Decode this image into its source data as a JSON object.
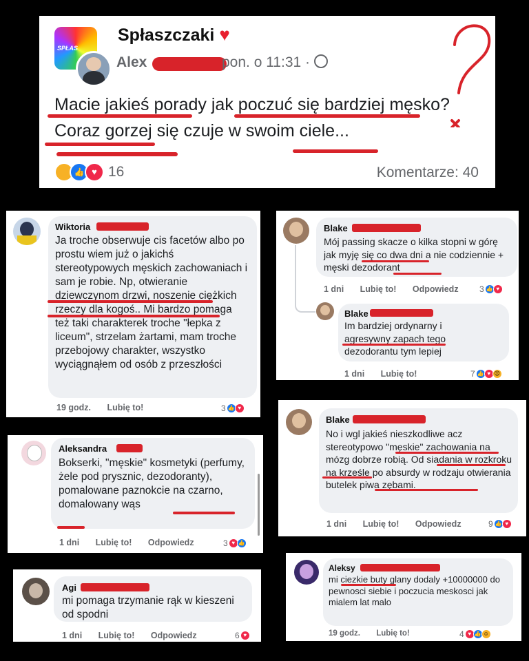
{
  "post": {
    "group_name": "Spłaszczaki",
    "group_logo_text": "SPŁAS",
    "author": "Alex",
    "time": "pon. o 11:31 ·",
    "text": "Macie jakieś porady jak poczuć się bardziej męsko? Coraz gorzej się czuje w swoim ciele...",
    "reaction_count": "16",
    "comments_label": "Komentarze: 40"
  },
  "comments": {
    "wiktoria": {
      "name": "Wiktoria",
      "text": "Ja troche obserwuje cis facetów albo po prostu wiem już o jakichś stereotypowych męskich zachowaniach i sam je robie. Np, otwieranie dziewczynom drzwi, noszenie ciężkich rzeczy dla kogoś.. Mi bardzo pomaga też taki charakterek troche \"łepka z liceum\", strzelam żartami, mam troche przebojowy charakter, wszystko wyciągnąłem od osób z przeszłości",
      "time": "19 godz.",
      "like": "Lubię to!",
      "reactions": "3"
    },
    "aleksandra": {
      "name": "Aleksandra",
      "text": "Bokserki, \"męskie\" kosmetyki (perfumy, żele pod prysznic, dezodoranty), pomalowane paznokcie na czarno, domalowany wąs",
      "time": "1 dni",
      "like": "Lubię to!",
      "reply": "Odpowiedz",
      "reactions": "3"
    },
    "agi": {
      "name": "Agi",
      "text": "mi pomaga trzymanie rąk w kieszeni od spodni",
      "time": "1 dni",
      "like": "Lubię to!",
      "reply": "Odpowiedz",
      "reactions": "6"
    },
    "blake1": {
      "name": "Blake",
      "text": "Mój passing skacze o kilka stopni w górę jak myję się co dwa dni a nie codziennie + męski dezodorant",
      "time": "1 dni",
      "like": "Lubię to!",
      "reply": "Odpowiedz",
      "reactions": "3"
    },
    "blake_reply": {
      "name": "Blake",
      "text": "Im bardziej ordynarny i agresywny zapach tego dezodorantu tym lepiej",
      "time": "1 dni",
      "like": "Lubię to!",
      "reactions": "7"
    },
    "blake2": {
      "name": "Blake",
      "text": "No i wgl jakieś nieszkodliwe acz stereotypowo \"męskie\" zachowania na mózg dobrze robią. Od siadania w rozkroku na krześle po absurdy w rodzaju otwierania butelek piwa zębami.",
      "time": "1 dni",
      "like": "Lubię to!",
      "reply": "Odpowiedz",
      "reactions": "9"
    },
    "aleksy": {
      "name": "Aleksy",
      "text": "mi ciezkie buty glany dodaly +10000000 do pewnosci siebie i poczucia meskosci jak mialem lat malo",
      "time": "19 godz.",
      "like": "Lubię to!",
      "reactions": "4"
    }
  }
}
